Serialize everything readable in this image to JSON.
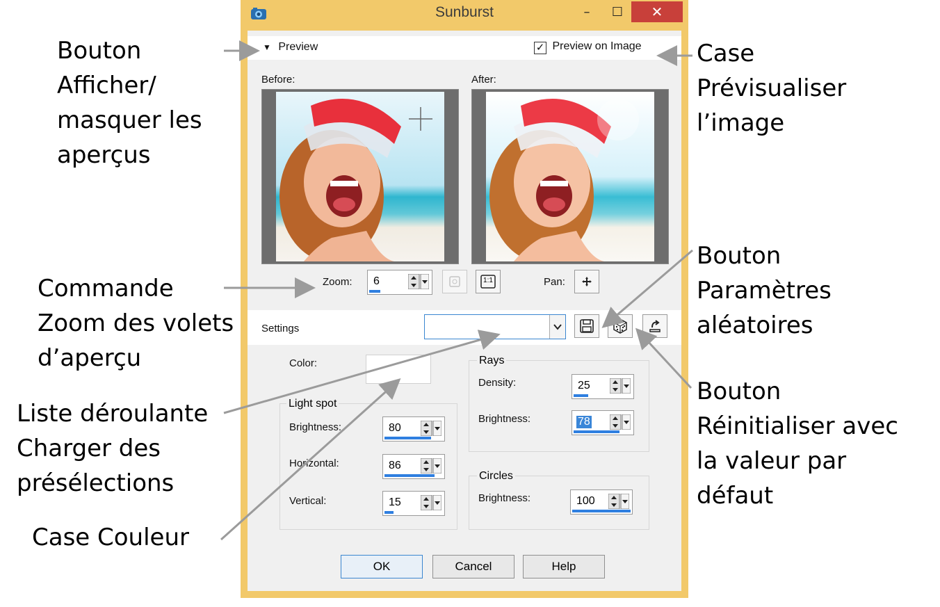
{
  "window": {
    "title": "Sunburst",
    "min_glyph": "–",
    "max_glyph": "☐",
    "close_glyph": "✕"
  },
  "preview": {
    "toggle_label": "Preview",
    "preview_on_image_label": "Preview on Image",
    "preview_on_image_checked": true,
    "before_label": "Before:",
    "after_label": "After:",
    "zoom_label": "Zoom:",
    "zoom_value": "6",
    "zoom_fraction": 0.18,
    "actual_size_label": "1:1",
    "pan_label": "Pan:"
  },
  "settings": {
    "label": "Settings",
    "preset_value": ""
  },
  "controls": {
    "color_label": "Color:",
    "color_value": "#ffffff",
    "light_spot": {
      "title": "Light spot",
      "brightness_label": "Brightness:",
      "brightness_value": "80",
      "brightness_fraction": 0.8,
      "horizontal_label": "Horizontal:",
      "horizontal_value": "86",
      "horizontal_fraction": 0.86,
      "vertical_label": "Vertical:",
      "vertical_value": "15",
      "vertical_fraction": 0.15
    },
    "rays": {
      "title": "Rays",
      "density_label": "Density:",
      "density_value": "25",
      "density_fraction": 0.25,
      "brightness_label": "Brightness:",
      "brightness_value": "78",
      "brightness_fraction": 0.78
    },
    "circles": {
      "title": "Circles",
      "brightness_label": "Brightness:",
      "brightness_value": "100",
      "brightness_fraction": 1.0
    }
  },
  "buttons": {
    "ok": "OK",
    "cancel": "Cancel",
    "help": "Help"
  },
  "callouts": {
    "show_hide_previews": "Bouton\nAfficher/\nmasquer les\naperçus",
    "preview_on_image": "Case\nPrévisualiser\nl’image",
    "zoom_control": "Commande\nZoom des volets\nd’aperçu",
    "random_params": "Bouton\nParamètres\naléatoires",
    "presets_dropdown": "Liste déroulante\nCharger des\nprésélections",
    "reset_default": "Bouton\nRéinitialiser avec\nla valeur par\ndéfaut",
    "color_box": "Case Couleur"
  },
  "colors": {
    "frame_accent": "#f2c96a",
    "close_red": "#c8403a",
    "value_bar": "#2f7fe0"
  }
}
